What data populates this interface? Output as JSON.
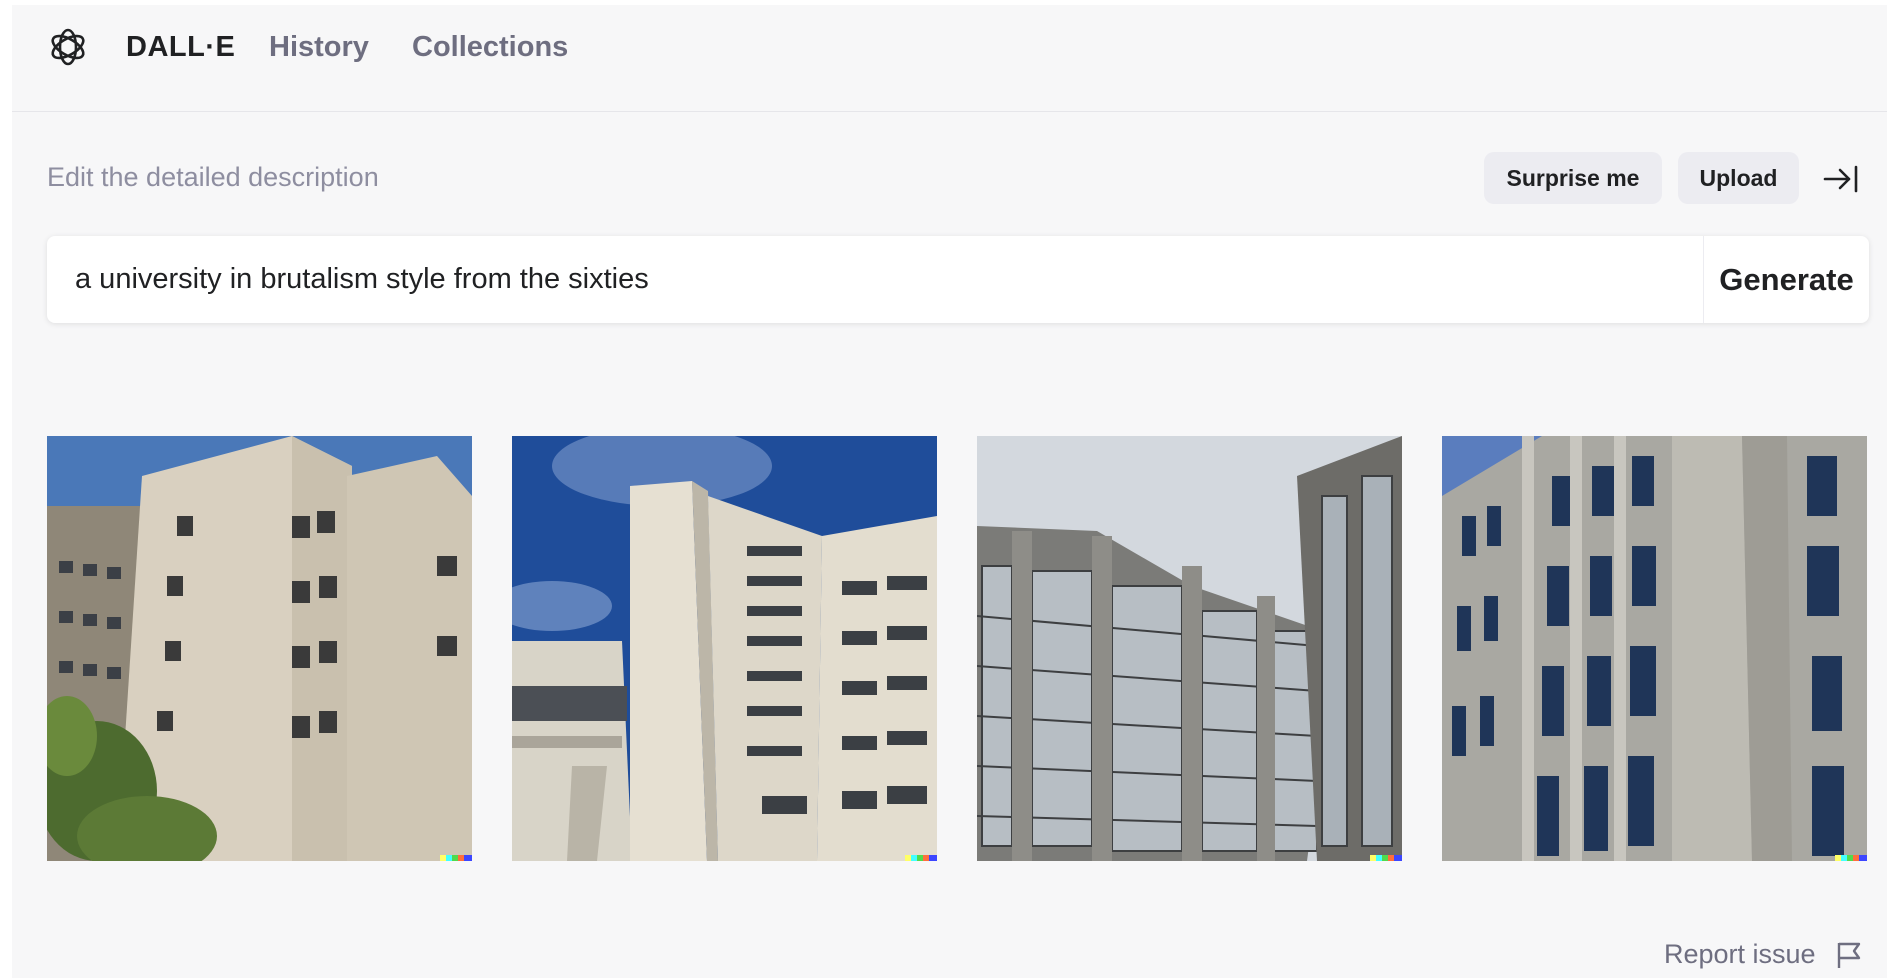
{
  "nav": {
    "brand": "DALL·E",
    "history": "History",
    "collections": "Collections",
    "logo_icon": "openai-logo-icon"
  },
  "prompt": {
    "label": "Edit the detailed description",
    "surprise_label": "Surprise me",
    "upload_label": "Upload",
    "collapse_icon": "arrow-right-to-bar-icon",
    "value": "a university in brutalism style from the sixties",
    "generate_label": "Generate"
  },
  "results": {
    "images": [
      {
        "subject": "beige concrete tower block with small windows and trees, blue sky"
      },
      {
        "subject": "white concrete wings with ribbon windows, deep blue sky with clouds"
      },
      {
        "subject": "grey concrete frame facade with grid glazing, overcast sky"
      },
      {
        "subject": "close-up of concrete fin facade with blue windows"
      }
    ]
  },
  "footer": {
    "report_label": "Report issue",
    "report_icon": "flag-icon"
  },
  "colors": {
    "background": "#f7f7f8",
    "pill": "#ececf1",
    "muted_text": "#6e6e80",
    "label_text": "#8e8ea0",
    "watermark": [
      "#ffff66",
      "#42ffff",
      "#51da4c",
      "#ff6e3c",
      "#3c46ff"
    ]
  }
}
